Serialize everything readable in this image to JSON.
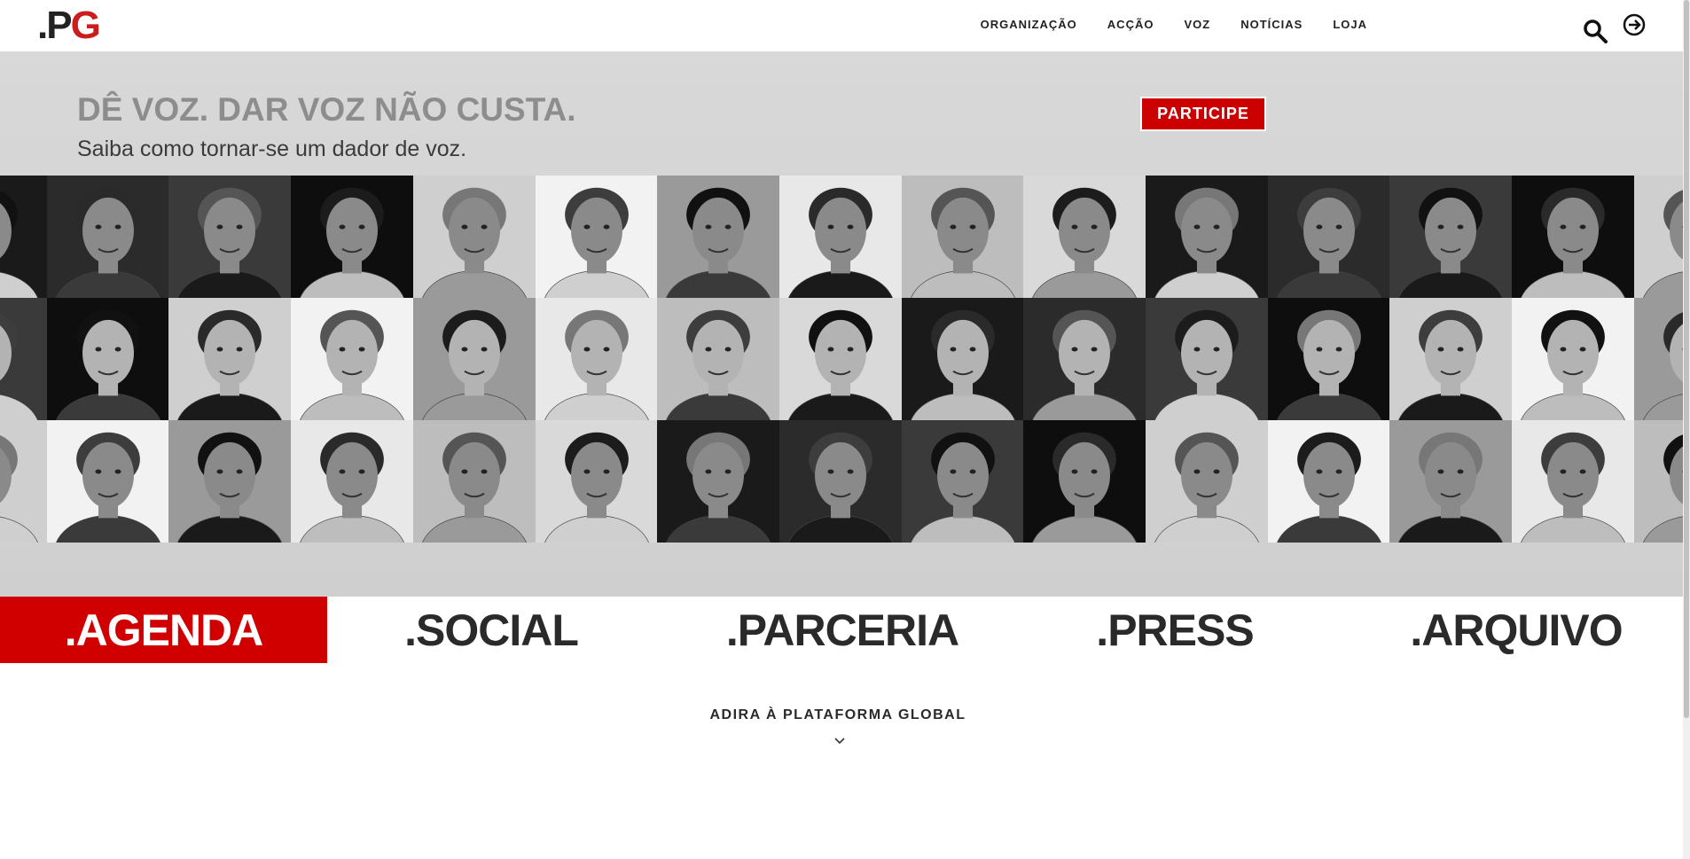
{
  "logo": {
    "dot_p": ".P",
    "g": "G"
  },
  "nav": {
    "items": [
      "ORGANIZAÇÃO",
      "ACÇÃO",
      "VOZ",
      "NOTÍCIAS",
      "LOJA"
    ]
  },
  "hero": {
    "title": "DÊ VOZ. DAR VOZ NÃO CUSTA.",
    "subtitle": "Saiba como tornar-se um dador de voz.",
    "cta": "PARTICIPE"
  },
  "tabs": [
    ".AGENDA",
    ".SOCIAL",
    ".PARCERIA",
    ".PRESS",
    ".ARQUIVO"
  ],
  "footer_cta": {
    "label": "ADIRA À PLATAFORMA GLOBAL"
  },
  "colors": {
    "accent": "#cc0000",
    "logo_g": "#cc1d1d",
    "text": "#2a2a2a"
  }
}
